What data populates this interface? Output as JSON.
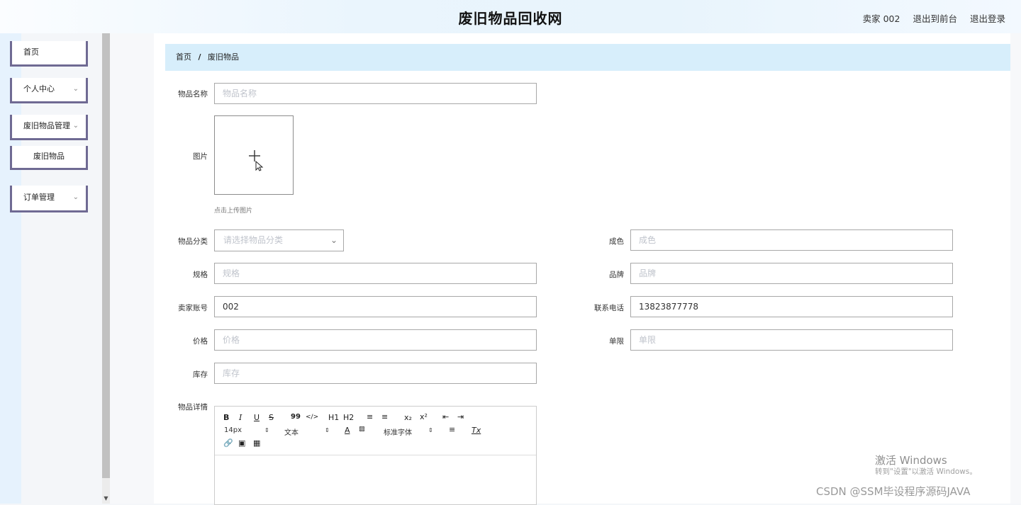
{
  "header": {
    "site_title": "废旧物品回收网",
    "user_label": "卖家 002",
    "to_front_label": "退出到前台",
    "logout_label": "退出登录"
  },
  "sidebar": {
    "items": [
      {
        "label": "首页"
      },
      {
        "label": "个人中心",
        "icon": "chevron-down-icon"
      },
      {
        "label": "废旧物品管理",
        "icon": "chevron-down-icon"
      },
      {
        "label": "废旧物品"
      },
      {
        "label": "订单管理",
        "icon": "chevron-down-icon"
      }
    ]
  },
  "breadcrumb": {
    "home": "首页",
    "separator": "/",
    "current": "废旧物品"
  },
  "form": {
    "item_name": {
      "label": "物品名称",
      "placeholder": "物品名称",
      "value": ""
    },
    "image": {
      "label": "图片",
      "hint": "点击上传图片"
    },
    "category": {
      "label": "物品分类",
      "placeholder": "请选择物品分类"
    },
    "condition": {
      "label": "成色",
      "placeholder": "成色",
      "value": ""
    },
    "spec": {
      "label": "规格",
      "placeholder": "规格",
      "value": ""
    },
    "brand": {
      "label": "品牌",
      "placeholder": "品牌",
      "value": ""
    },
    "seller_account": {
      "label": "卖家账号",
      "placeholder": "",
      "value": "002"
    },
    "phone": {
      "label": "联系电话",
      "placeholder": "",
      "value": "13823877778"
    },
    "price": {
      "label": "价格",
      "placeholder": "价格",
      "value": ""
    },
    "limit": {
      "label": "单限",
      "placeholder": "单限",
      "value": ""
    },
    "stock": {
      "label": "库存",
      "placeholder": "库存",
      "value": ""
    },
    "details": {
      "label": "物品详情"
    }
  },
  "editor": {
    "bold": "B",
    "italic": "I",
    "underline": "U",
    "strike": "S",
    "quote": "99",
    "code": "</>",
    "h1": "H1",
    "h2": "H2",
    "sub": "x₂",
    "sup": "x²",
    "font_size": "14px",
    "text_style": "文本",
    "font_family": "标准字体",
    "clear": "Tx"
  },
  "overlay": {
    "windows_title": "激活 Windows",
    "windows_sub": "转到\"设置\"以激活 Windows。",
    "csdn": "CSDN @SSM毕设程序源码JAVA"
  }
}
